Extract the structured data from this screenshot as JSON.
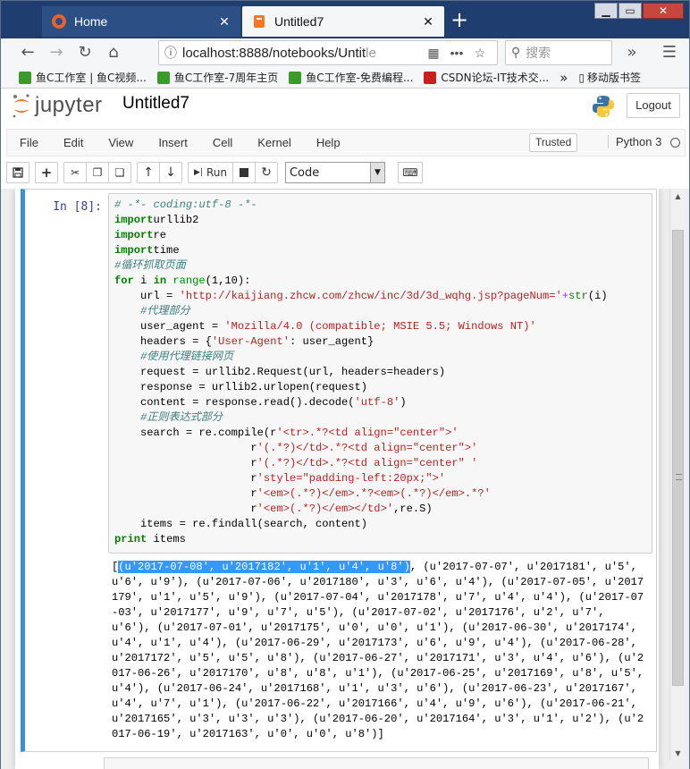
{
  "browser": {
    "tabs": [
      {
        "label": "Home"
      },
      {
        "label": "Untitled7"
      }
    ],
    "new_tab": "+",
    "window_controls": {
      "minimize": "▁",
      "maximize": "▭",
      "close": "✕"
    },
    "nav": {
      "back": "←",
      "forward": "→",
      "reload": "↻",
      "home": "⌂"
    },
    "url_main": "localhost:8888/notebooks/Untit",
    "url_dim": "le",
    "search_placeholder": "搜索",
    "overflow_label": "»",
    "menu_label": "☰"
  },
  "bookmarks": [
    {
      "label": "鱼C工作室 | 鱼C视频...",
      "color": "#3a9a2a"
    },
    {
      "label": "鱼C工作室-7周年主页",
      "color": "#3a9a2a"
    },
    {
      "label": "鱼C工作室-免费编程...",
      "color": "#3a9a2a"
    },
    {
      "label": "CSDN论坛-IT技术交...",
      "color": "#c9201f"
    }
  ],
  "bookmarks_more": "»",
  "bookmarks_mobile": "移动版书签",
  "jupyter": {
    "logo_text": "jupyter",
    "notebook_title": "Untitled7",
    "logout_label": "Logout",
    "accent": "#f37726"
  },
  "menubar": {
    "items": [
      "File",
      "Edit",
      "View",
      "Insert",
      "Cell",
      "Kernel",
      "Help"
    ],
    "trusted": "Trusted",
    "kernel": "Python 3"
  },
  "toolbar": {
    "run_label": "Run",
    "cell_type": "Code"
  },
  "cell": {
    "prompt": "In  [8]:",
    "code_lines": [
      [
        [
          "cm",
          "# -*- coding:utf-8 -*-"
        ]
      ],
      [
        [
          "kw",
          "import"
        ],
        [
          "",
          "urllib2"
        ]
      ],
      [
        [
          "kw",
          "import"
        ],
        [
          "",
          "re"
        ]
      ],
      [
        [
          "kw",
          "import"
        ],
        [
          "",
          "time"
        ]
      ],
      [
        [
          "cm",
          "#循环抓取页面"
        ]
      ],
      [
        [
          "kw",
          "for"
        ],
        [
          "",
          " i "
        ],
        [
          "kw",
          "in"
        ],
        [
          "",
          " "
        ],
        [
          "nu",
          "range"
        ],
        [
          "",
          "(1,10):"
        ]
      ],
      [
        [
          "",
          "    url = "
        ],
        [
          "st",
          "'http://kaijiang.zhcw.com/zhcw/inc/3d/3d_wqhg.jsp?pageNum='"
        ],
        [
          "op",
          "+"
        ],
        [
          "nu",
          "str"
        ],
        [
          "",
          "(i)"
        ]
      ],
      [
        [
          "cm",
          "    #代理部分"
        ]
      ],
      [
        [
          "",
          "    user_agent = "
        ],
        [
          "st",
          "'Mozilla/4.0 (compatible; MSIE 5.5; Windows NT)'"
        ]
      ],
      [
        [
          "",
          "    headers = {"
        ],
        [
          "st",
          "'User-Agent'"
        ],
        [
          "",
          ": user_agent}"
        ]
      ],
      [
        [
          "cm",
          "    #使用代理链接网页"
        ]
      ],
      [
        [
          "",
          "    request = urllib2.Request(url, headers=headers)"
        ]
      ],
      [
        [
          "",
          "    response = urllib2.urlopen(request)"
        ]
      ],
      [
        [
          "",
          "    content = response.read().decode("
        ],
        [
          "st",
          "'utf-8'"
        ],
        [
          "",
          ")"
        ]
      ],
      [
        [
          "cm",
          "    #正则表达式部分"
        ]
      ],
      [
        [
          "",
          "    search = re.compile(r"
        ],
        [
          "st",
          "'<tr>.*?<td align=\"center\">'"
        ]
      ],
      [
        [
          "",
          "                     r"
        ],
        [
          "st",
          "'(.*?)</td>.*?<td align=\"center\">'"
        ]
      ],
      [
        [
          "",
          "                     r"
        ],
        [
          "st",
          "'(.*?)</td>.*?<td align=\"center\" '"
        ]
      ],
      [
        [
          "",
          "                     r"
        ],
        [
          "st",
          "'style=\"padding-left:20px;\">'"
        ]
      ],
      [
        [
          "",
          "                     r"
        ],
        [
          "st",
          "'<em>(.*?)</em>.*?<em>(.*?)</em>.*?'"
        ]
      ],
      [
        [
          "",
          "                     r"
        ],
        [
          "st",
          "'<em>(.*?)</em></td>'"
        ],
        [
          "",
          ",re.S)"
        ]
      ],
      [
        [
          "",
          "    items = re.findall(search, content)"
        ]
      ],
      [
        [
          "kw",
          "print"
        ],
        [
          "",
          " items"
        ]
      ]
    ],
    "output_open": "[",
    "output_selected": "(u'2017-07-08', u'2017182', u'1', u'4', u'8')",
    "output_rest": ", (u'2017-07-07', u'2017181', u'5', u'6', u'9'), (u'2017-07-06', u'2017180', u'3', u'6', u'4'), (u'2017-07-05', u'2017179', u'1', u'5', u'9'), (u'2017-07-04', u'2017178', u'7', u'4', u'4'), (u'2017-07-03', u'2017177', u'9', u'7', u'5'), (u'2017-07-02', u'2017176', u'2', u'7', u'6'), (u'2017-07-01', u'2017175', u'0', u'0', u'1'), (u'2017-06-30', u'2017174', u'4', u'1', u'4'), (u'2017-06-29', u'2017173', u'6', u'9', u'4'), (u'2017-06-28', u'2017172', u'5', u'5', u'8'), (u'2017-06-27', u'2017171', u'3', u'4', u'6'), (u'2017-06-26', u'2017170', u'8', u'8', u'1'), (u'2017-06-25', u'2017169', u'8', u'5', u'4'), (u'2017-06-24', u'2017168', u'1', u'3', u'6'), (u'2017-06-23', u'2017167', u'4', u'7', u'1'), (u'2017-06-22', u'2017166', u'4', u'9', u'6'), (u'2017-06-21', u'2017165', u'3', u'3', u'3'), (u'2017-06-20', u'2017164', u'3', u'1', u'2'), (u'2017-06-19', u'2017163', u'0', u'0', u'8')]"
  }
}
